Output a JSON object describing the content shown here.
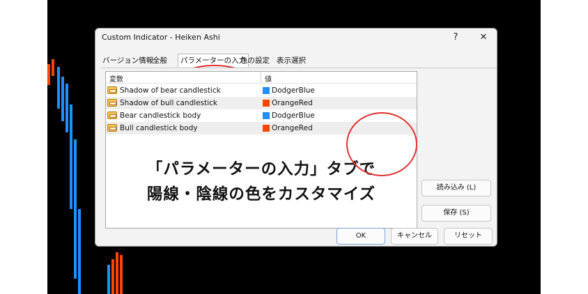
{
  "colors": {
    "bear": "#1e90ff",
    "bull": "#ff4500",
    "annotation": "#e03030"
  },
  "dialog": {
    "title": "Custom Indicator - Heiken Ashi",
    "help_label": "?",
    "close_label": "✕",
    "tabs": [
      {
        "label": "バージョン情報"
      },
      {
        "label": "全般"
      },
      {
        "label": "パラメーターの入力"
      },
      {
        "label": "色の設定"
      },
      {
        "label": "表示選択"
      }
    ],
    "table": {
      "headers": {
        "variable": "変数",
        "value": "値"
      },
      "rows": [
        {
          "name": "Shadow of bear candlestick",
          "value": "DodgerBlue",
          "color": "#1e90ff"
        },
        {
          "name": "Shadow of bull candlestick",
          "value": "OrangeRed",
          "color": "#ff4500"
        },
        {
          "name": "Bear candlestick body",
          "value": "DodgerBlue",
          "color": "#1e90ff"
        },
        {
          "name": "Bull candlestick body",
          "value": "OrangeRed",
          "color": "#ff4500"
        }
      ]
    },
    "buttons": {
      "load": "読み込み (L)",
      "save": "保存 (S)",
      "ok": "OK",
      "cancel": "キャンセル",
      "reset": "リセット"
    }
  },
  "caption": {
    "line1": "「パラメーターの入力」タブで",
    "line2": "陽線・陰線の色をカスタマイズ"
  }
}
